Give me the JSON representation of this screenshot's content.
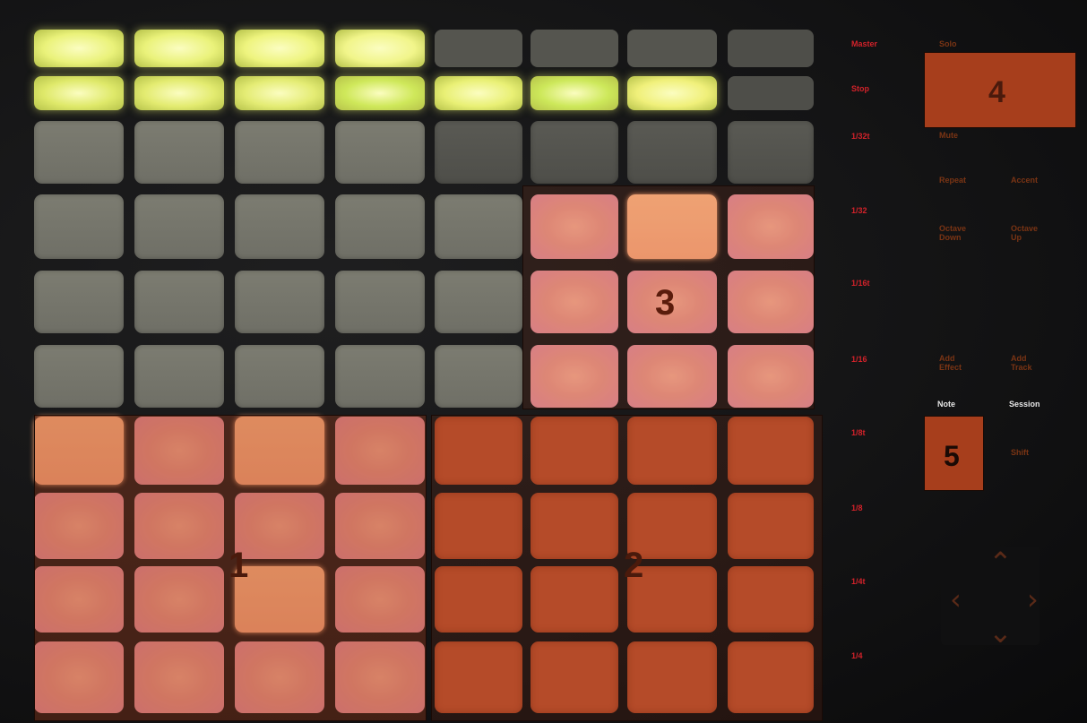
{
  "colors": {
    "zone_fill": "#a73e1c",
    "zone_label": "#4a1a0c",
    "scene_button_text": "#d2222a",
    "peach_pad": "#f7a67b",
    "pink_pad": "#e79486",
    "dim_pad": "#76766c",
    "yellow_pad": "#e8f07a"
  },
  "zones": [
    {
      "id": "zone-1",
      "label": "1"
    },
    {
      "id": "zone-2",
      "label": "2"
    },
    {
      "id": "zone-3",
      "label": "3"
    },
    {
      "id": "zone-4",
      "label": "4"
    },
    {
      "id": "zone-5",
      "label": "5"
    }
  ],
  "scene_buttons": [
    {
      "label": "Master"
    },
    {
      "label": "Stop"
    },
    {
      "label": "1/32t"
    },
    {
      "label": "1/32"
    },
    {
      "label": "1/16t"
    },
    {
      "label": "1/16"
    },
    {
      "label": "1/8t"
    },
    {
      "label": "1/8"
    },
    {
      "label": "1/4t"
    },
    {
      "label": "1/4"
    }
  ],
  "control_buttons": [
    {
      "label": "Solo"
    },
    {
      "label": "Mute"
    },
    {
      "label": "Repeat"
    },
    {
      "label": "Accent"
    },
    {
      "label": "Octave Down"
    },
    {
      "label": "Octave Up"
    },
    {
      "label": "Add Effect"
    },
    {
      "label": "Add Track"
    },
    {
      "label": "Note"
    },
    {
      "label": "Session"
    },
    {
      "label": "Shift"
    }
  ],
  "nav_icons": [
    "up-arrow",
    "left-arrow",
    "right-arrow",
    "down-arrow"
  ]
}
